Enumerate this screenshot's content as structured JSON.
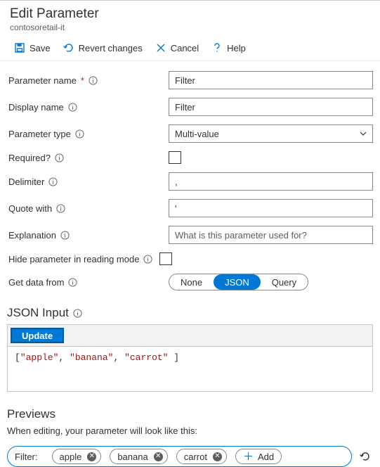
{
  "header": {
    "title": "Edit Parameter",
    "subtitle": "contosoretail-it"
  },
  "toolbar": {
    "save": "Save",
    "revert": "Revert changes",
    "cancel": "Cancel",
    "help": "Help"
  },
  "labels": {
    "param_name": "Parameter name",
    "display_name": "Display name",
    "param_type": "Parameter type",
    "required": "Required?",
    "delimiter": "Delimiter",
    "quote_with": "Quote with",
    "explanation": "Explanation",
    "hide_param": "Hide parameter in reading mode",
    "get_data": "Get data from"
  },
  "fields": {
    "param_name": "Filter",
    "display_name": "Filter",
    "param_type": "Multi-value",
    "delimiter": ",",
    "quote_with": "'",
    "explanation_placeholder": "What is this parameter used for?"
  },
  "get_data_options": {
    "none": "None",
    "json": "JSON",
    "query": "Query"
  },
  "json_section": {
    "title": "JSON Input",
    "update": "Update",
    "code_parts": {
      "open": "[",
      "s1": "\"apple\"",
      "c": ", ",
      "s2": "\"banana\"",
      "s3": "\"carrot\"",
      "close": " ]"
    }
  },
  "previews": {
    "title": "Previews",
    "subtitle": "When editing, your parameter will look like this:",
    "filter_label": "Filter:",
    "tags": [
      "apple",
      "banana",
      "carrot"
    ],
    "add": "Add"
  }
}
